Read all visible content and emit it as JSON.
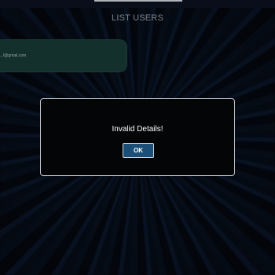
{
  "header": {
    "title": "LIST USERS"
  },
  "users": [
    {
      "email": "...l@gmail.com"
    }
  ],
  "dialog": {
    "message": "Invalid Details!",
    "ok_label": "OK"
  },
  "colors": {
    "background": "#05080d",
    "card": "#193b38",
    "dialog_bg": "#040507",
    "dialog_border": "#bfc4ca",
    "button_bg": "#1b4f77"
  }
}
